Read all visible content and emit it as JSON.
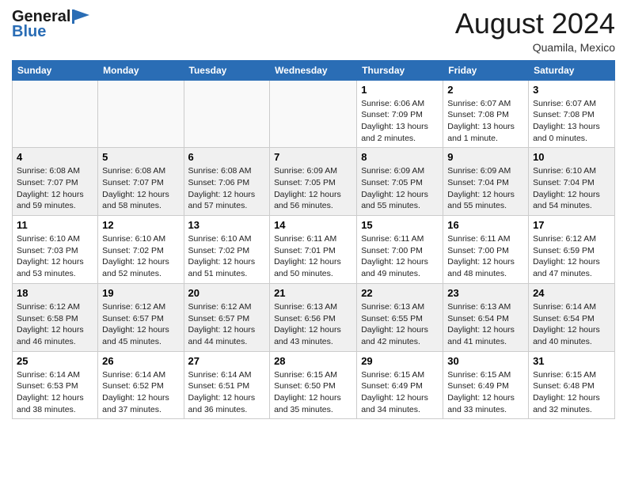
{
  "header": {
    "logo_general": "General",
    "logo_blue": "Blue",
    "month_title": "August 2024",
    "location": "Quamila, Mexico"
  },
  "calendar": {
    "days_of_week": [
      "Sunday",
      "Monday",
      "Tuesday",
      "Wednesday",
      "Thursday",
      "Friday",
      "Saturday"
    ],
    "weeks": [
      [
        {
          "day": "",
          "info": "",
          "empty": true
        },
        {
          "day": "",
          "info": "",
          "empty": true
        },
        {
          "day": "",
          "info": "",
          "empty": true
        },
        {
          "day": "",
          "info": "",
          "empty": true
        },
        {
          "day": "1",
          "info": "Sunrise: 6:06 AM\nSunset: 7:09 PM\nDaylight: 13 hours\nand 2 minutes."
        },
        {
          "day": "2",
          "info": "Sunrise: 6:07 AM\nSunset: 7:08 PM\nDaylight: 13 hours\nand 1 minute."
        },
        {
          "day": "3",
          "info": "Sunrise: 6:07 AM\nSunset: 7:08 PM\nDaylight: 13 hours\nand 0 minutes."
        }
      ],
      [
        {
          "day": "4",
          "info": "Sunrise: 6:08 AM\nSunset: 7:07 PM\nDaylight: 12 hours\nand 59 minutes."
        },
        {
          "day": "5",
          "info": "Sunrise: 6:08 AM\nSunset: 7:07 PM\nDaylight: 12 hours\nand 58 minutes."
        },
        {
          "day": "6",
          "info": "Sunrise: 6:08 AM\nSunset: 7:06 PM\nDaylight: 12 hours\nand 57 minutes."
        },
        {
          "day": "7",
          "info": "Sunrise: 6:09 AM\nSunset: 7:05 PM\nDaylight: 12 hours\nand 56 minutes."
        },
        {
          "day": "8",
          "info": "Sunrise: 6:09 AM\nSunset: 7:05 PM\nDaylight: 12 hours\nand 55 minutes."
        },
        {
          "day": "9",
          "info": "Sunrise: 6:09 AM\nSunset: 7:04 PM\nDaylight: 12 hours\nand 55 minutes."
        },
        {
          "day": "10",
          "info": "Sunrise: 6:10 AM\nSunset: 7:04 PM\nDaylight: 12 hours\nand 54 minutes."
        }
      ],
      [
        {
          "day": "11",
          "info": "Sunrise: 6:10 AM\nSunset: 7:03 PM\nDaylight: 12 hours\nand 53 minutes."
        },
        {
          "day": "12",
          "info": "Sunrise: 6:10 AM\nSunset: 7:02 PM\nDaylight: 12 hours\nand 52 minutes."
        },
        {
          "day": "13",
          "info": "Sunrise: 6:10 AM\nSunset: 7:02 PM\nDaylight: 12 hours\nand 51 minutes."
        },
        {
          "day": "14",
          "info": "Sunrise: 6:11 AM\nSunset: 7:01 PM\nDaylight: 12 hours\nand 50 minutes."
        },
        {
          "day": "15",
          "info": "Sunrise: 6:11 AM\nSunset: 7:00 PM\nDaylight: 12 hours\nand 49 minutes."
        },
        {
          "day": "16",
          "info": "Sunrise: 6:11 AM\nSunset: 7:00 PM\nDaylight: 12 hours\nand 48 minutes."
        },
        {
          "day": "17",
          "info": "Sunrise: 6:12 AM\nSunset: 6:59 PM\nDaylight: 12 hours\nand 47 minutes."
        }
      ],
      [
        {
          "day": "18",
          "info": "Sunrise: 6:12 AM\nSunset: 6:58 PM\nDaylight: 12 hours\nand 46 minutes."
        },
        {
          "day": "19",
          "info": "Sunrise: 6:12 AM\nSunset: 6:57 PM\nDaylight: 12 hours\nand 45 minutes."
        },
        {
          "day": "20",
          "info": "Sunrise: 6:12 AM\nSunset: 6:57 PM\nDaylight: 12 hours\nand 44 minutes."
        },
        {
          "day": "21",
          "info": "Sunrise: 6:13 AM\nSunset: 6:56 PM\nDaylight: 12 hours\nand 43 minutes."
        },
        {
          "day": "22",
          "info": "Sunrise: 6:13 AM\nSunset: 6:55 PM\nDaylight: 12 hours\nand 42 minutes."
        },
        {
          "day": "23",
          "info": "Sunrise: 6:13 AM\nSunset: 6:54 PM\nDaylight: 12 hours\nand 41 minutes."
        },
        {
          "day": "24",
          "info": "Sunrise: 6:14 AM\nSunset: 6:54 PM\nDaylight: 12 hours\nand 40 minutes."
        }
      ],
      [
        {
          "day": "25",
          "info": "Sunrise: 6:14 AM\nSunset: 6:53 PM\nDaylight: 12 hours\nand 38 minutes."
        },
        {
          "day": "26",
          "info": "Sunrise: 6:14 AM\nSunset: 6:52 PM\nDaylight: 12 hours\nand 37 minutes."
        },
        {
          "day": "27",
          "info": "Sunrise: 6:14 AM\nSunset: 6:51 PM\nDaylight: 12 hours\nand 36 minutes."
        },
        {
          "day": "28",
          "info": "Sunrise: 6:15 AM\nSunset: 6:50 PM\nDaylight: 12 hours\nand 35 minutes."
        },
        {
          "day": "29",
          "info": "Sunrise: 6:15 AM\nSunset: 6:49 PM\nDaylight: 12 hours\nand 34 minutes."
        },
        {
          "day": "30",
          "info": "Sunrise: 6:15 AM\nSunset: 6:49 PM\nDaylight: 12 hours\nand 33 minutes."
        },
        {
          "day": "31",
          "info": "Sunrise: 6:15 AM\nSunset: 6:48 PM\nDaylight: 12 hours\nand 32 minutes."
        }
      ]
    ]
  }
}
